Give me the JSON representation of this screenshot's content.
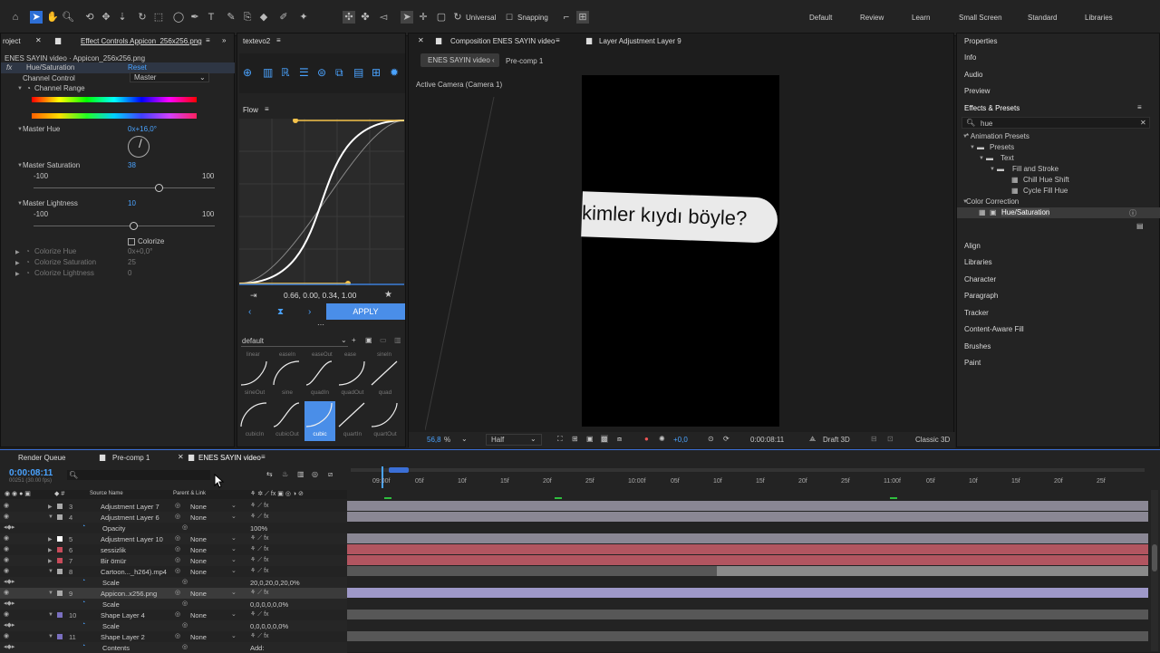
{
  "toolbar": {
    "universal_label": "Universal",
    "snapping_label": "Snapping",
    "workspaces": [
      "Default",
      "Review",
      "Learn",
      "Small Screen",
      "Standard",
      "Libraries"
    ]
  },
  "effect_controls": {
    "project_tab": "roject",
    "tab": "Effect Controls Appicon_256x256.png",
    "subtitle": "ENES SAYIN video · Appicon_256x256.png",
    "effect_name": "Hue/Saturation",
    "reset": "Reset",
    "channel_control_label": "Channel Control",
    "channel_control_value": "Master",
    "channel_range": "Channel Range",
    "master_hue_label": "Master Hue",
    "master_hue_value": "0x+16,0°",
    "master_sat_label": "Master Saturation",
    "master_sat_value": "38",
    "sat_min": "-100",
    "sat_max": "100",
    "master_light_label": "Master Lightness",
    "master_light_value": "10",
    "light_min": "-100",
    "light_max": "100",
    "colorize": "Colorize",
    "colorize_hue_label": "Colorize Hue",
    "colorize_hue_value": "0x+0,0°",
    "colorize_sat_label": "Colorize Saturation",
    "colorize_sat_value": "25",
    "colorize_light_label": "Colorize Lightness",
    "colorize_light_value": "0",
    "saturation_level": 0.69,
    "lightness_level": 0.55
  },
  "textevo": {
    "tab": "textevo2"
  },
  "flow": {
    "tab": "Flow",
    "bezier": "0.66, 0.00, 0.34, 1.00",
    "apply": "APPLY",
    "preset": "default",
    "curves_row1": [
      "linear",
      "easeIn",
      "easeOut",
      "ease",
      "sineIn"
    ],
    "curves_row2": [
      "sineOut",
      "sine",
      "quadIn",
      "quadOut",
      "quad"
    ],
    "curves_row3": [
      "cubicIn",
      "cubicOut",
      "cubic",
      "quartIn",
      "quartOut"
    ]
  },
  "composition": {
    "tab": "Composition ENES SAYIN video",
    "layer_tab": "Layer Adjustment Layer 9",
    "crumb1": "ENES SAYIN video",
    "crumb2": "Pre-comp 1",
    "camera": "Active Camera (Camera 1)",
    "caption": "kimler kıydı böyle?",
    "zoom": "56,8",
    "zoom_pct": "%",
    "quality": "Half",
    "exposure": "+0,0",
    "timecode": "0:00:08:11",
    "draft": "Draft 3D",
    "renderer": "Classic 3D"
  },
  "right_panel": {
    "properties": "Properties",
    "info": "Info",
    "audio": "Audio",
    "preview": "Preview",
    "effects_presets": "Effects & Presets",
    "search": "hue",
    "tree": [
      "* Animation Presets",
      "Presets",
      "Text",
      "Fill and Stroke",
      "Chill Hue Shift",
      "Cycle Fill Hue",
      "Color Correction",
      "Hue/Saturation"
    ],
    "panels": [
      "Align",
      "Libraries",
      "Character",
      "Paragraph",
      "Tracker",
      "Content-Aware Fill",
      "Brushes",
      "Paint"
    ]
  },
  "timeline": {
    "tabs": [
      "Render Queue",
      "Pre-comp 1",
      "ENES SAYIN video"
    ],
    "timecode": "0:00:08:11",
    "fps": "00251 (30.00 fps)",
    "col_source": "Source Name",
    "col_parent": "Parent & Link",
    "ruler": [
      "09:00f",
      "05f",
      "10f",
      "15f",
      "20f",
      "25f",
      "10:00f",
      "05f",
      "10f",
      "15f",
      "20f",
      "25f",
      "11:00f",
      "05f",
      "10f",
      "15f",
      "20f",
      "25f"
    ],
    "layers": [
      {
        "num": "3",
        "name": "Adjustment Layer 7",
        "parent": "None"
      },
      {
        "num": "4",
        "name": "Adjustment Layer 6",
        "parent": "None"
      },
      {
        "num": "",
        "name": "Opacity",
        "parent": "",
        "value": "100%"
      },
      {
        "num": "5",
        "name": "Adjustment Layer 10",
        "parent": "None"
      },
      {
        "num": "6",
        "name": "sessizlik",
        "parent": "None"
      },
      {
        "num": "7",
        "name": "Bir ömür",
        "parent": "None"
      },
      {
        "num": "8",
        "name": "Cartoon..._h264).mp4",
        "parent": "None"
      },
      {
        "num": "",
        "name": "Scale",
        "parent": "",
        "value": "20,0,20,0,20,0%"
      },
      {
        "num": "9",
        "name": "Appicon..x256.png",
        "parent": "None"
      },
      {
        "num": "",
        "name": "Scale",
        "parent": "",
        "value": "0,0,0,0,0,0%"
      },
      {
        "num": "10",
        "name": "Shape Layer 4",
        "parent": "None"
      },
      {
        "num": "",
        "name": "Scale",
        "parent": "",
        "value": "0,0,0,0,0,0%"
      },
      {
        "num": "11",
        "name": "Shape Layer 2",
        "parent": "None"
      },
      {
        "num": "",
        "name": "Contents",
        "parent": "",
        "value": "Add:"
      }
    ]
  }
}
